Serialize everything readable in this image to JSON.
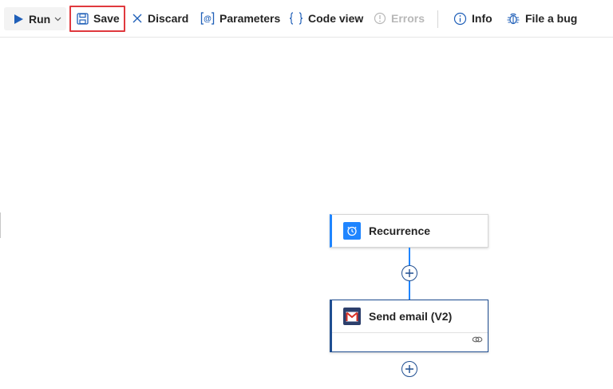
{
  "toolbar": {
    "run_label": "Run",
    "save_label": "Save",
    "discard_label": "Discard",
    "parameters_label": "Parameters",
    "code_view_label": "Code view",
    "errors_label": "Errors",
    "info_label": "Info",
    "file_bug_label": "File a bug"
  },
  "workflow": {
    "steps": [
      {
        "title": "Recurrence",
        "icon": "clock-icon",
        "color": "#1f85ff"
      },
      {
        "title": "Send email (V2)",
        "icon": "gmail-icon",
        "color": "#1f4e91"
      }
    ]
  },
  "colors": {
    "accent": "#1f85ff",
    "highlight": "#e0393e",
    "selected_border": "#1f4e91"
  }
}
